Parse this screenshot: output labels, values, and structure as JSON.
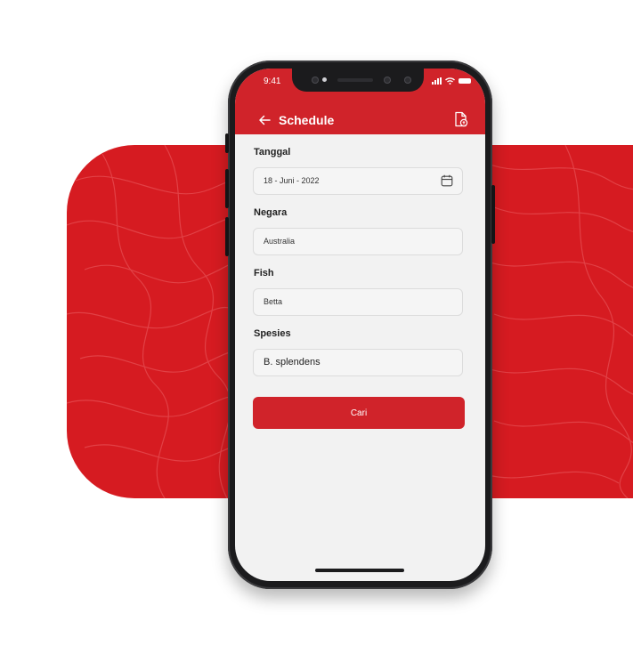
{
  "status_bar": {
    "time": "9:41"
  },
  "header": {
    "title": "Schedule",
    "back_icon": "arrow-left-icon",
    "action_icon": "document-icon"
  },
  "form": {
    "fields": [
      {
        "label": "Tanggal",
        "value": "18 - Juni - 2022",
        "icon": "calendar-icon"
      },
      {
        "label": "Negara",
        "value": "Australia"
      },
      {
        "label": "Fish",
        "value": "Betta"
      },
      {
        "label": "Spesies",
        "value": "B. splendens"
      }
    ],
    "submit_label": "Cari"
  },
  "colors": {
    "brand_red": "#d0232a",
    "background_band": "#d61b21",
    "field_background": "#f5f5f5",
    "phone_frame": "#1b1b1d"
  }
}
